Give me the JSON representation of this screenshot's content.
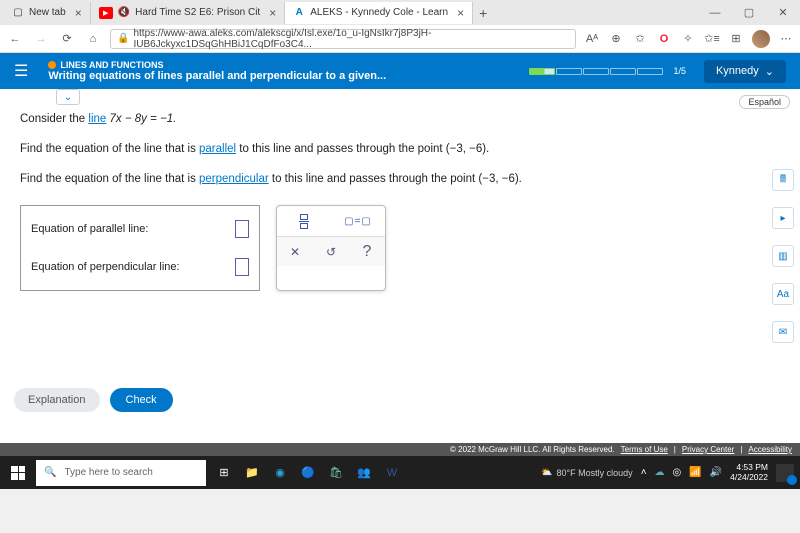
{
  "browser": {
    "tabs": [
      {
        "label": "New tab"
      },
      {
        "label": "Hard Time S2 E6: Prison Cit"
      },
      {
        "label": "ALEKS - Kynnedy Cole - Learn"
      }
    ],
    "url": "https://www-awa.aleks.com/alekscgi/x/Isl.exe/1o_u-IgNsIkr7j8P3jH-IUB6Jckyxc1DSqGhHBiJ1CqDfFo3C4..."
  },
  "header": {
    "category": "LINES AND FUNCTIONS",
    "topic": "Writing equations of lines parallel and perpendicular to a given...",
    "progress": "1/5",
    "user": "Kynnedy"
  },
  "lang_button": "Español",
  "problem": {
    "p1a": "Consider the ",
    "p1link": "line",
    "p1b": " 7x − 8y = −1.",
    "p2a": "Find the equation of the line that is ",
    "p2link": "parallel",
    "p2b": " to this line and passes through the point (−3, −6).",
    "p3a": "Find the equation of the line that is ",
    "p3link": "perpendicular",
    "p3b": " to this line and passes through the point (−3, −6)."
  },
  "answers": {
    "parallel_label": "Equation of parallel line:",
    "perp_label": "Equation of perpendicular line:"
  },
  "buttons": {
    "explanation": "Explanation",
    "check": "Check"
  },
  "footer": {
    "copyright": "© 2022 McGraw Hill LLC. All Rights Reserved.",
    "terms": "Terms of Use",
    "privacy": "Privacy Center",
    "access": "Accessibility"
  },
  "taskbar": {
    "search_placeholder": "Type here to search",
    "weather": "80°F  Mostly cloudy",
    "time": "4:53 PM",
    "date": "4/24/2022"
  }
}
